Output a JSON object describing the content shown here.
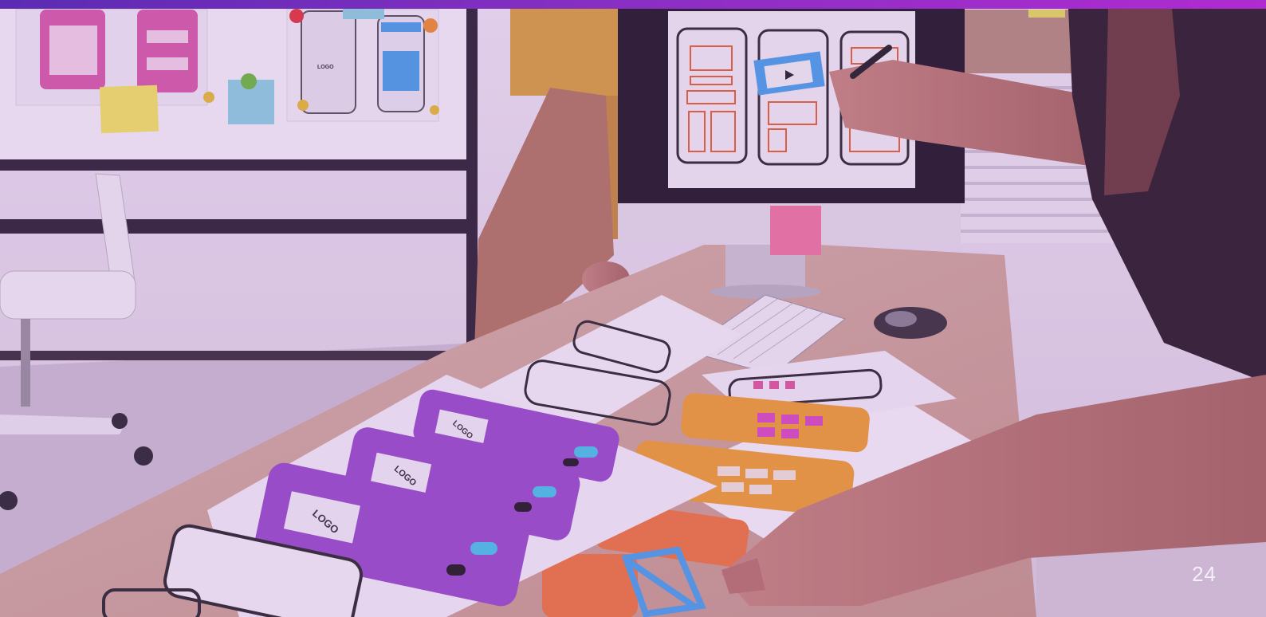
{
  "slide": {
    "page_number": "24",
    "accent_gradient": [
      "#5b2bb3",
      "#b02bd0"
    ]
  },
  "photo": {
    "mockup_labels": {
      "logo": "LOGO"
    }
  }
}
